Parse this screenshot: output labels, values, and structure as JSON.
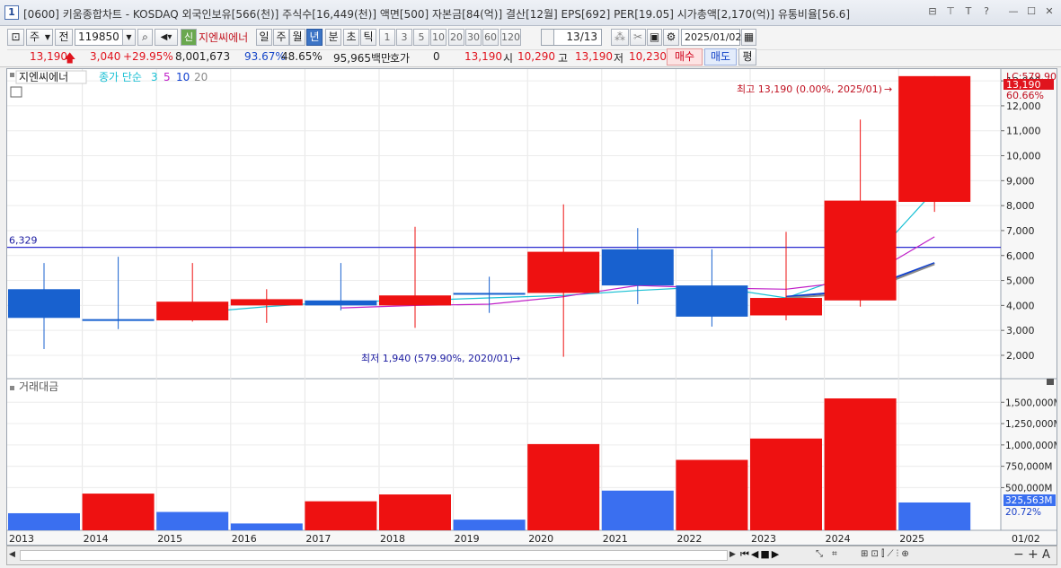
{
  "window": {
    "number": "1",
    "title": "[0600] 키움종합차트 - KOSDAQ 외국인보유[566(천)] 주식수[16,449(천)] 액면[500] 자본금[84(억)] 결산[12월] EPS[692] PER[19.05] 시가총액[2,170(억)] 유통비율[56.6]",
    "icons": [
      "window-icon",
      "layout-icon",
      "pin-icon",
      "font-icon",
      "help-icon",
      "minimize-icon",
      "maximize-icon",
      "close-icon"
    ],
    "icon_glyphs": [
      "⧉",
      "⊟",
      "⊤",
      "T",
      "?",
      "—",
      "☐",
      "✕"
    ]
  },
  "toolbar": {
    "period_type": "주",
    "scope": "전",
    "stock_code": "119850",
    "stock_name": "지엔씨에너",
    "stock_tag": "신",
    "periods": [
      "일",
      "주",
      "월",
      "년",
      "분",
      "초",
      "틱"
    ],
    "active_period": "년",
    "minute_options": [
      "1",
      "3",
      "5",
      "10",
      "20",
      "30",
      "60",
      "120"
    ],
    "count": "13",
    "total": "/13",
    "date": "2025/01/02"
  },
  "quote": {
    "price": "13,190",
    "change": "3,040",
    "change_pct": "+29.95%",
    "volume": "8,001,673",
    "vol_ratio": "93.67%",
    "turnover": "48.65%",
    "amount": "95,965백만",
    "hoga_label": "호가",
    "hoga_value": "0",
    "hoga_price": "13,190",
    "open_label": "시",
    "open": "10,290",
    "high_label": "고",
    "high": "13,190",
    "low_label": "저",
    "low": "10,230",
    "buy_label": "매수",
    "sell_label": "매도",
    "eval_label": "평"
  },
  "chart_data": [
    {
      "type": "candlestick",
      "title": "지엔씨에너",
      "legend": {
        "label": "종가 단순",
        "periods": [
          "3",
          "5",
          "10",
          "20"
        ],
        "colors": [
          "#19c0d4",
          "#c020c8",
          "#1040d0",
          "#8a8a8a"
        ]
      },
      "x": [
        "2013",
        "2014",
        "2015",
        "2016",
        "2017",
        "2018",
        "2019",
        "2020",
        "2021",
        "2022",
        "2023",
        "2024",
        "2025"
      ],
      "open": [
        4650,
        3450,
        3400,
        4000,
        4200,
        4000,
        4500,
        4500,
        6250,
        4800,
        3600,
        4200,
        8150
      ],
      "high": [
        5700,
        5950,
        5700,
        4650,
        5700,
        7150,
        5150,
        8050,
        7100,
        6250,
        6950,
        11450,
        13190
      ],
      "low": [
        2250,
        3050,
        3350,
        3300,
        3800,
        3100,
        3700,
        1940,
        4050,
        3150,
        3400,
        3950,
        7750
      ],
      "close": [
        3500,
        3400,
        4150,
        4250,
        4000,
        4400,
        4450,
        6150,
        4800,
        3550,
        4300,
        8200,
        13190
      ],
      "ma3": [
        null,
        null,
        3700,
        3950,
        4150,
        4200,
        4300,
        4400,
        4600,
        4750,
        4300,
        5350,
        8600
      ],
      "ma5": [
        null,
        null,
        null,
        null,
        3900,
        4000,
        4050,
        4350,
        4800,
        4700,
        4650,
        5000,
        6750
      ],
      "ma10": [
        null,
        null,
        null,
        null,
        null,
        null,
        null,
        null,
        null,
        null,
        4350,
        4600,
        5700
      ],
      "ma20": [
        null,
        null,
        null,
        null,
        null,
        null,
        null,
        null,
        null,
        null,
        4300,
        4500,
        5650
      ],
      "hline": {
        "label": "6,329",
        "value": 6329
      },
      "max_annotation": "최고 13,190 (0.00%, 2025/01)",
      "min_annotation": "최저 1,940 (579.90%, 2020/01)",
      "y_ticks": [
        "13,000",
        "12,000",
        "11,000",
        "10,000",
        "9,000",
        "8,000",
        "7,000",
        "6,000",
        "5,000",
        "4,000",
        "3,000",
        "2,000"
      ],
      "y_tick_values": [
        13000,
        12000,
        11000,
        10000,
        9000,
        8000,
        7000,
        6000,
        5000,
        4000,
        3000,
        2000
      ],
      "ylim": [
        1100,
        13400
      ],
      "price_tag": "13,190",
      "price_tag_pct": "60.66%",
      "upper_label": "LC:579.90",
      "up_color": "#ee1111",
      "down_color": "#1861cf"
    },
    {
      "type": "bar",
      "title": "거래대금",
      "x": [
        "2013",
        "2014",
        "2015",
        "2016",
        "2017",
        "2018",
        "2019",
        "2020",
        "2021",
        "2022",
        "2023",
        "2024",
        "2025"
      ],
      "values": [
        200,
        430,
        215,
        80,
        340,
        420,
        125,
        1010,
        465,
        825,
        1075,
        1545,
        326
      ],
      "unit": "M",
      "colors": [
        "blue",
        "red",
        "blue",
        "blue",
        "red",
        "red",
        "blue",
        "red",
        "blue",
        "red",
        "red",
        "red",
        "blue"
      ],
      "y_ticks": [
        "1,500,000M",
        "1,250,000M",
        "1,000,000M",
        "750,000M",
        "500,000M"
      ],
      "y_tick_values": [
        1500,
        1250,
        1000,
        750,
        500
      ],
      "ylim": [
        0,
        1650
      ],
      "value_tag": "325,563M",
      "value_tag_pct": "20.72%",
      "last_date": "01/02"
    }
  ]
}
